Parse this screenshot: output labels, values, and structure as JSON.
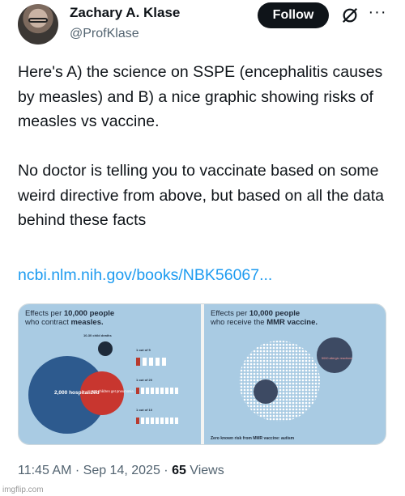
{
  "author": {
    "name": "Zachary A. Klase",
    "handle": "@ProfKlase"
  },
  "actions": {
    "follow_label": "Follow",
    "grok_icon": "grok-icon",
    "more_icon": "more-icon"
  },
  "tweet": {
    "paragraph1": "Here's A) the science on SSPE (encephalitis causes by measles) and B) a nice graphic showing risks of measles vs vaccine.",
    "paragraph2": "No doctor is telling you to vaccinate based on some weird directive from above, but based on all the data behind these facts",
    "link": "ncbi.nlm.nih.gov/books/NBK56067..."
  },
  "graphic": {
    "left": {
      "title_prefix": "Effects per ",
      "title_count": "10,000 people",
      "title_line2_prefix": "who contract ",
      "title_line2_strong": "measles.",
      "deaths_label": "10-30 child deaths",
      "hospitalized_label": "2,000 hospitalized",
      "pneumonia_label": "500 children get pneumonia",
      "ratio1": "1 out of 5",
      "ratio2": "1 out of 20",
      "ratio3": "1 out of 10"
    },
    "right": {
      "title_prefix": "Effects per ",
      "title_count": "10,000 people",
      "title_line2_prefix": "who receive the ",
      "title_line2_strong": "MMR vaccine.",
      "allergic_label": "5000 allergic reactions",
      "footer": "Zero known risk from MMR vaccine: autism"
    },
    "colors": {
      "panel_bg": "#a9cbe3",
      "measles_circle": "#2d5a8e",
      "pneumonia_circle": "#c8362f",
      "figure_red": "#b83a2e"
    }
  },
  "meta": {
    "time": "11:45 AM",
    "separator": " · ",
    "date": "Sep 14, 2025",
    "views_count": "65",
    "views_label": " Views"
  },
  "watermark": "imgflip.com"
}
